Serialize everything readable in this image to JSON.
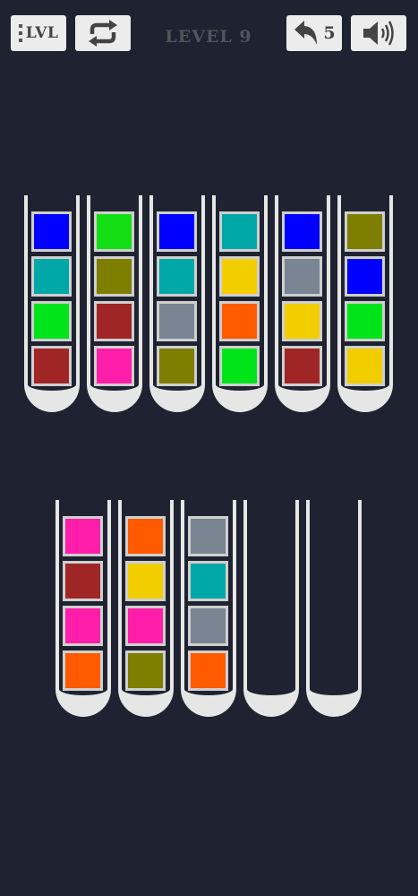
{
  "toolbar": {
    "lvl_label": "LVL",
    "level_title": "LEVEL 9",
    "undo_count": "5"
  },
  "colors": {
    "blue": "#0000ff",
    "teal": "#00a7a7",
    "green": "#00e51a",
    "dark_red": "#a02626",
    "lime": "#12e015",
    "olive": "#7e7e00",
    "pink": "#ff1eaa",
    "gray": "#7a8594",
    "yellow": "#f2ce00",
    "orange": "#ff5a00"
  },
  "board": {
    "capacity": 4,
    "tubes": [
      {
        "balls": [
          "blue",
          "teal",
          "green",
          "dark_red"
        ]
      },
      {
        "balls": [
          "lime",
          "olive",
          "dark_red",
          "pink"
        ]
      },
      {
        "balls": [
          "blue",
          "teal",
          "gray",
          "olive"
        ]
      },
      {
        "balls": [
          "teal",
          "yellow",
          "orange",
          "green"
        ]
      },
      {
        "balls": [
          "blue",
          "gray",
          "yellow",
          "dark_red"
        ]
      },
      {
        "balls": [
          "olive",
          "blue",
          "green",
          "yellow"
        ]
      },
      {
        "balls": [
          "pink",
          "dark_red",
          "pink",
          "orange"
        ]
      },
      {
        "balls": [
          "orange",
          "yellow",
          "pink",
          "olive"
        ]
      },
      {
        "balls": [
          "gray",
          "teal",
          "gray",
          "orange"
        ]
      },
      {
        "balls": []
      },
      {
        "balls": []
      }
    ]
  }
}
